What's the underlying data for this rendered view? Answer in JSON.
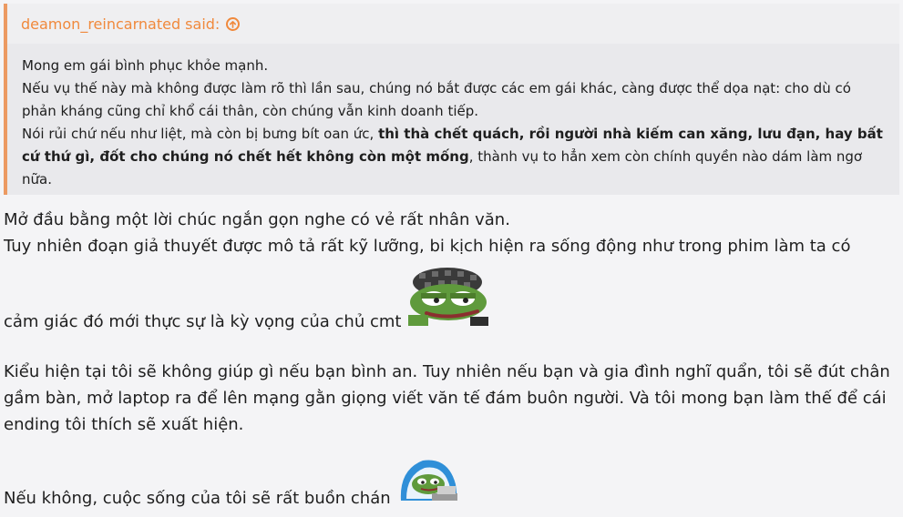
{
  "quote": {
    "author_said": "deamon_reincarnated said:",
    "lines": [
      "Mong em gái bình phục khỏe mạnh.",
      "Nếu vụ thế này mà không được làm rõ thì lần sau, chúng nó bắt được các em gái khác, càng được thể dọa nạt: cho dù có phản kháng cũng chỉ khổ cái thân, còn chúng vẫn kinh doanh tiếp."
    ],
    "last_line_start": "Nói rủi chứ nếu như liệt, mà còn bị bưng bít oan ức, ",
    "last_line_bold": "thì thà chết quách, rồi người nhà kiếm can xăng, lưu đạn, hay bất cứ thứ gì, đốt cho chúng nó chết hết không còn một mống",
    "last_line_end": ", thành vụ to hẳn xem còn chính quyền nào dám làm ngơ nữa."
  },
  "reply": {
    "line1": "Mở đầu bằng một lời chúc ngắn gọn nghe có vẻ rất nhân văn.",
    "line2": "Tuy nhiên đoạn giả thuyết được mô tả rất kỹ lưỡng, bi kịch hiện ra sống động như trong phim làm ta có",
    "line3": "cảm giác đó mới thực sự là kỳ vọng của chủ cmt",
    "paragraph2": "Kiểu hiện tại tôi sẽ không giúp gì nếu bạn bình an. Tuy nhiên nếu bạn và gia đình nghĩ quẩn, tôi sẽ đút chân gầm bàn, mở laptop ra để lên mạng gằn giọng viết văn tế đám buôn người. Và tôi mong bạn làm thế để cái ending tôi thích sẽ xuất hiện.",
    "line_last": "Nếu không, cuộc sống của tôi sẽ rất buồn chán"
  },
  "icons": {
    "said_icon": "arrow-up-circle-icon",
    "emoji1": "pepe-detective-smirk-emoji",
    "emoji2": "pepe-blanket-emoji"
  },
  "colors": {
    "accent": "#f0893c",
    "quote_border": "#ec9a62",
    "quote_bg": "#e9e9ec",
    "page_bg": "#f4f4f6"
  }
}
